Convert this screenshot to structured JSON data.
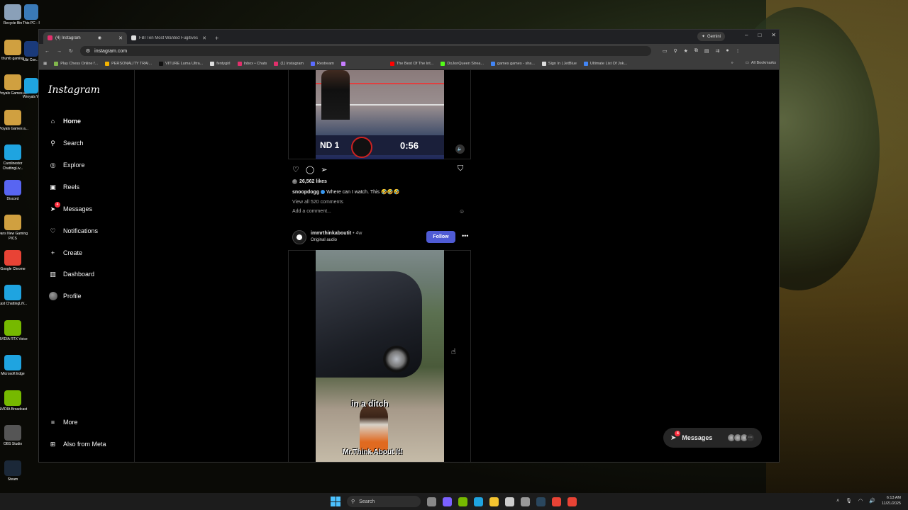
{
  "desktop": {
    "icons": [
      {
        "label": "Recycle Bin",
        "color": "#8aa0b8"
      },
      {
        "label": "thumb gaming",
        "color": "#d0a040"
      },
      {
        "label": "Wroyals Games a...",
        "color": "#d0a040"
      },
      {
        "label": "Wroyals Games a...",
        "color": "#d0a040"
      },
      {
        "label": "Carolinestor ChattingLiv...",
        "color": "#1fa4e0"
      },
      {
        "label": "Discord",
        "color": "#5865f2"
      },
      {
        "label": "Dans New Gaming PICS",
        "color": "#d0a040"
      },
      {
        "label": "Google Chrome",
        "color": "#e84335"
      },
      {
        "label": "kast ChattingLiV...",
        "color": "#1fa4e0"
      },
      {
        "label": "NVIDIA RTX Voice",
        "color": "#76b900"
      },
      {
        "label": "Microsoft Edge",
        "color": "#1fa4e0"
      },
      {
        "label": "NVIDIA Broadcast",
        "color": "#76b900"
      },
      {
        "label": "OBS Studio",
        "color": "#555"
      },
      {
        "label": "Steam",
        "color": "#1b2838"
      }
    ],
    "icons2": [
      {
        "label": "This PC - Shortcut",
        "color": "#3a7ab8"
      },
      {
        "label": "Ubi Con...",
        "color": "#1a3a7a"
      },
      {
        "label": "Wroyals Wareh...",
        "color": "#1fa4e0"
      }
    ]
  },
  "browser": {
    "tabs": [
      {
        "label": "(4) Instagram",
        "active": true,
        "color": "#e1306c"
      },
      {
        "label": "FBI Ten Most Wanted Fugitives",
        "active": false,
        "color": "#ffffff"
      }
    ],
    "new_tab": "+",
    "gemini_label": "Gemini",
    "controls": {
      "minimize": "–",
      "maximize": "□",
      "close": "✕"
    },
    "url": "instagram.com",
    "bookmarks": [
      {
        "label": "Play Chess Online f...",
        "color": "#81b64c"
      },
      {
        "label": "PERSONALITY TRAI...",
        "color": "#f4b400"
      },
      {
        "label": "VITURE Luma Ultra...",
        "color": "#111111"
      },
      {
        "label": "fentygirl",
        "color": "#dddddd"
      },
      {
        "label": "Inbox • Chats",
        "color": "#e1306c"
      },
      {
        "label": "(1) Instagram",
        "color": "#e1306c"
      },
      {
        "label": "Restream",
        "color": "#5b6cff"
      },
      {
        "label": "",
        "color": "#c77dff"
      },
      {
        "label": "The Best Of The Int...",
        "color": "#ff0000"
      },
      {
        "label": "DoJonQueen Strea...",
        "color": "#53fc18"
      },
      {
        "label": "games games - sha...",
        "color": "#4285f4"
      },
      {
        "label": "Sign In | JetBlue",
        "color": "#dddddd"
      },
      {
        "label": "Ultimate List Of Jok...",
        "color": "#4285f4"
      }
    ],
    "bookmarks_more": "»",
    "all_bookmarks": "All Bookmarks"
  },
  "instagram": {
    "logo": "Instagram",
    "nav": [
      {
        "key": "home",
        "label": "Home",
        "icon": "home-icon",
        "glyph": "⌂"
      },
      {
        "key": "search",
        "label": "Search",
        "icon": "search-icon",
        "glyph": "⚲"
      },
      {
        "key": "explore",
        "label": "Explore",
        "icon": "compass-icon",
        "glyph": "◎"
      },
      {
        "key": "reels",
        "label": "Reels",
        "icon": "reels-icon",
        "glyph": "▣"
      },
      {
        "key": "messages",
        "label": "Messages",
        "icon": "paper-plane-icon",
        "glyph": "➤",
        "badge": "4"
      },
      {
        "key": "notifications",
        "label": "Notifications",
        "icon": "heart-icon",
        "glyph": "♡"
      },
      {
        "key": "create",
        "label": "Create",
        "icon": "plus-icon",
        "glyph": "+"
      },
      {
        "key": "dashboard",
        "label": "Dashboard",
        "icon": "dashboard-icon",
        "glyph": "▥"
      },
      {
        "key": "profile",
        "label": "Profile",
        "icon": "avatar",
        "glyph": ""
      }
    ],
    "nav_bottom": [
      {
        "key": "more",
        "label": "More",
        "icon": "menu-icon",
        "glyph": "≡"
      },
      {
        "key": "meta",
        "label": "Also from Meta",
        "icon": "meta-grid-icon",
        "glyph": "⊞"
      }
    ],
    "post1": {
      "round_text": "ND 1",
      "clock": "0:56",
      "likes": "26,562 likes",
      "caption_user": "snoopdogg",
      "caption_text": "Where can I watch. This 🤣🤣🤣",
      "view_comments": "View all 520 comments",
      "add_comment": "Add a comment..."
    },
    "post2": {
      "username": "immrthinkaboutit",
      "age": "• 4w",
      "audio": "Original audio",
      "follow_label": "Follow",
      "more": "•••",
      "overlay_text1": "in a ditch",
      "overlay_text2": "Mr.Think About It!"
    },
    "messages_pill": {
      "label": "Messages",
      "badge": "4",
      "more": "···"
    },
    "accent": "#4f5bd5"
  },
  "taskbar": {
    "search_placeholder": "Search",
    "apps": [
      {
        "name": "task-view",
        "color": "#888888"
      },
      {
        "name": "copilot",
        "color": "#7b61ff"
      },
      {
        "name": "nvidia",
        "color": "#76b900"
      },
      {
        "name": "edge",
        "color": "#1fa4e0"
      },
      {
        "name": "explorer",
        "color": "#f4c430"
      },
      {
        "name": "store",
        "color": "#cccccc"
      },
      {
        "name": "settings",
        "color": "#999999"
      },
      {
        "name": "steam",
        "color": "#2a475e"
      },
      {
        "name": "chrome-a",
        "color": "#e84335"
      },
      {
        "name": "chrome-b",
        "color": "#e84335"
      }
    ],
    "time": "6:13 AM",
    "date": "11/21/2025"
  }
}
